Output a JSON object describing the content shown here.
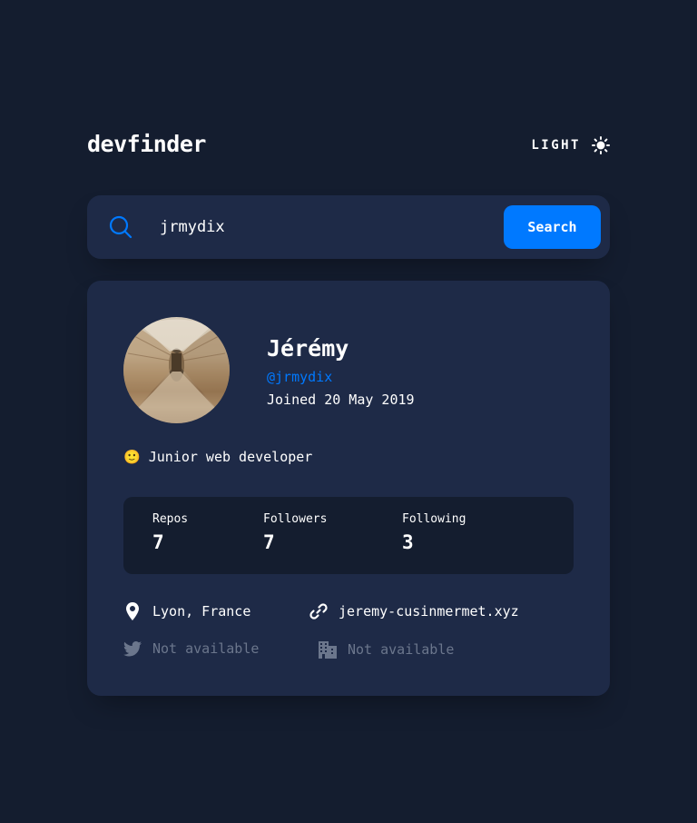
{
  "header": {
    "logo": "devfinder",
    "theme_label": "LIGHT"
  },
  "search": {
    "value": "jrmydix",
    "button_label": "Search"
  },
  "profile": {
    "name": "Jérémy",
    "login": "@jrmydix",
    "joined": "Joined 20 May 2019",
    "bio": "🙂 Junior web developer",
    "stats": {
      "repos_label": "Repos",
      "repos_value": "7",
      "followers_label": "Followers",
      "followers_value": "7",
      "following_label": "Following",
      "following_value": "3"
    },
    "links": {
      "location": "Lyon, France",
      "blog": "jeremy-cusinmermet.xyz",
      "twitter": "Not available",
      "company": "Not available"
    }
  },
  "icons": {
    "search": "search-icon",
    "theme": "sun-icon",
    "location": "location-pin-icon",
    "blog": "link-icon",
    "twitter": "twitter-icon",
    "company": "building-icon"
  },
  "colors": {
    "background": "#141d2f",
    "card": "#1e2a47",
    "accent": "#0079ff",
    "text": "#ffffff",
    "muted": "#6b768c"
  }
}
